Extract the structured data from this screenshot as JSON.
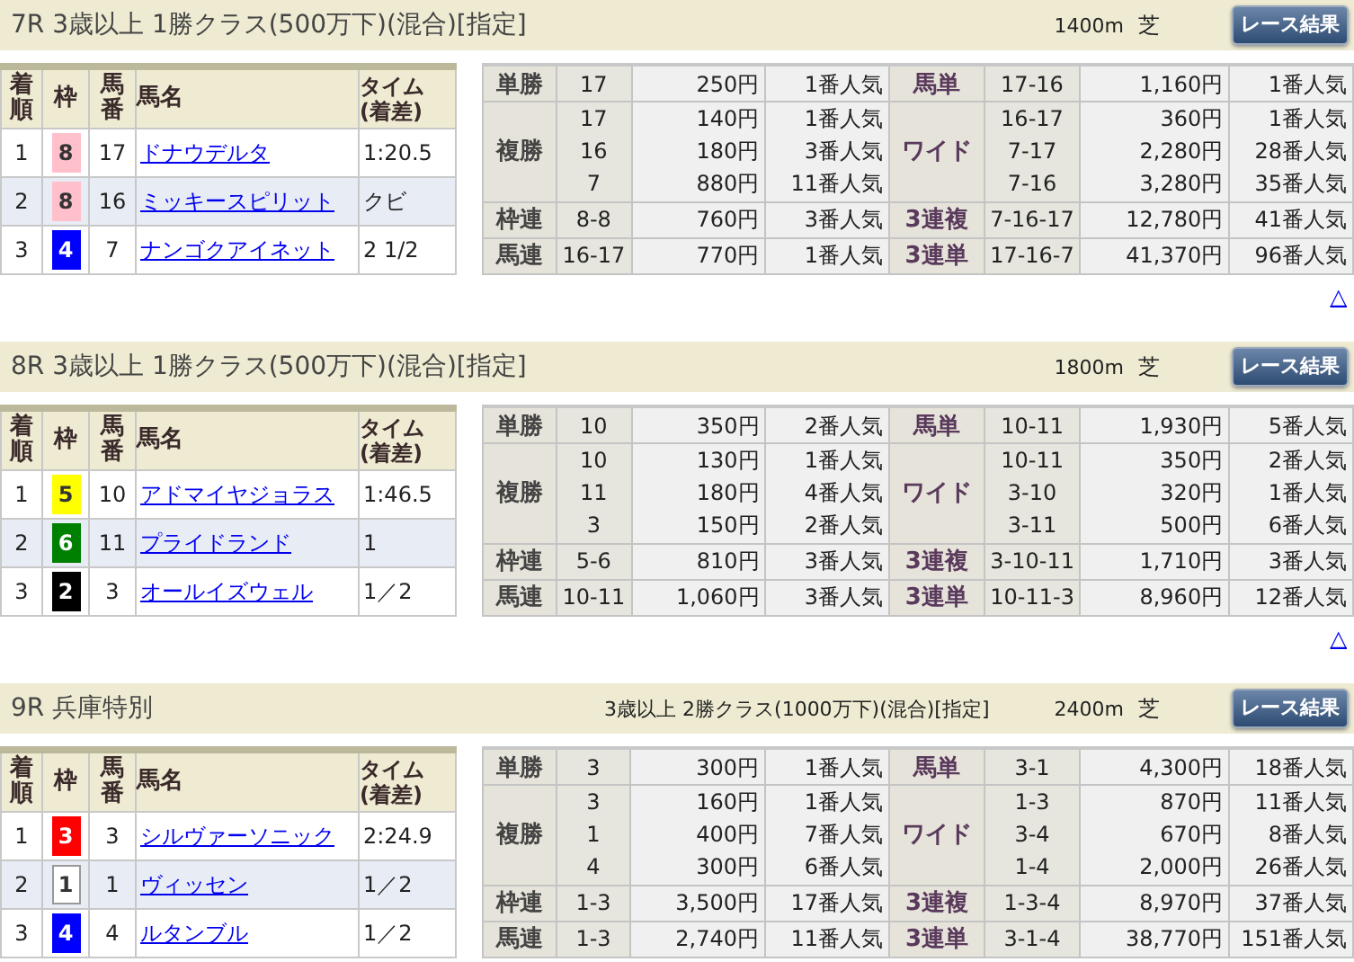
{
  "races": [
    {
      "title": "7R 3歳以上 1勝クラス(500万下)(混合)[指定]",
      "distance": "1400m",
      "surface": "芝",
      "result_button": "レース結果",
      "columns": [
        "着順",
        "枠",
        "馬番",
        "馬名",
        "タイム(着差)"
      ],
      "results": [
        {
          "rank": "1",
          "frame": "8",
          "color": "#ffc0cb",
          "horse_no": "17",
          "horse_name": "ドナウデルタ",
          "time": "1:20.5"
        },
        {
          "rank": "2",
          "frame": "8",
          "color": "#ffc0cb",
          "horse_no": "16",
          "horse_name": "ミッキースピリット",
          "time": "クビ"
        },
        {
          "rank": "3",
          "frame": "4",
          "color": "#0000ff",
          "horse_no": "7",
          "horse_name": "ナンゴクアイネット",
          "time": "2 1/2"
        }
      ],
      "payouts": [
        {
          "left": {
            "bet": "単勝",
            "entries": [
              {
                "combo": "17",
                "amount": "250円",
                "popularity": "1番人気"
              }
            ]
          },
          "right": {
            "bet": "馬単",
            "entries": [
              {
                "combo": "17-16",
                "amount": "1,160円",
                "popularity": "1番人気"
              }
            ]
          }
        },
        {
          "left": {
            "bet": "複勝",
            "entries": [
              {
                "combo": "17",
                "amount": "140円",
                "popularity": "1番人気"
              },
              {
                "combo": "16",
                "amount": "180円",
                "popularity": "3番人気"
              },
              {
                "combo": "7",
                "amount": "880円",
                "popularity": "11番人気"
              }
            ]
          },
          "right": {
            "bet": "ワイド",
            "entries": [
              {
                "combo": "16-17",
                "amount": "360円",
                "popularity": "1番人気"
              },
              {
                "combo": "7-17",
                "amount": "2,280円",
                "popularity": "28番人気"
              },
              {
                "combo": "7-16",
                "amount": "3,280円",
                "popularity": "35番人気"
              }
            ]
          }
        },
        {
          "left": {
            "bet": "枠連",
            "entries": [
              {
                "combo": "8-8",
                "amount": "760円",
                "popularity": "3番人気"
              }
            ]
          },
          "right": {
            "bet": "3連複",
            "entries": [
              {
                "combo": "7-16-17",
                "amount": "12,780円",
                "popularity": "41番人気"
              }
            ]
          }
        },
        {
          "left": {
            "bet": "馬連",
            "entries": [
              {
                "combo": "16-17",
                "amount": "770円",
                "popularity": "1番人気"
              }
            ]
          },
          "right": {
            "bet": "3連単",
            "entries": [
              {
                "combo": "17-16-7",
                "amount": "41,370円",
                "popularity": "96番人気"
              }
            ]
          }
        }
      ],
      "back_to_top": "△"
    },
    {
      "title": "8R 3歳以上 1勝クラス(500万下)(混合)[指定]",
      "distance": "1800m",
      "surface": "芝",
      "result_button": "レース結果",
      "columns": [
        "着順",
        "枠",
        "馬番",
        "馬名",
        "タイム(着差)"
      ],
      "results": [
        {
          "rank": "1",
          "frame": "5",
          "color": "#ffff00",
          "horse_no": "10",
          "horse_name": "アドマイヤジョラス",
          "time": "1:46.5"
        },
        {
          "rank": "2",
          "frame": "6",
          "color": "#008000",
          "horse_no": "11",
          "horse_name": "プライドランド",
          "time": "1"
        },
        {
          "rank": "3",
          "frame": "2",
          "color": "#000000",
          "horse_no": "3",
          "horse_name": "オールイズウェル",
          "time": "1／2"
        }
      ],
      "payouts": [
        {
          "left": {
            "bet": "単勝",
            "entries": [
              {
                "combo": "10",
                "amount": "350円",
                "popularity": "2番人気"
              }
            ]
          },
          "right": {
            "bet": "馬単",
            "entries": [
              {
                "combo": "10-11",
                "amount": "1,930円",
                "popularity": "5番人気"
              }
            ]
          }
        },
        {
          "left": {
            "bet": "複勝",
            "entries": [
              {
                "combo": "10",
                "amount": "130円",
                "popularity": "1番人気"
              },
              {
                "combo": "11",
                "amount": "180円",
                "popularity": "4番人気"
              },
              {
                "combo": "3",
                "amount": "150円",
                "popularity": "2番人気"
              }
            ]
          },
          "right": {
            "bet": "ワイド",
            "entries": [
              {
                "combo": "10-11",
                "amount": "350円",
                "popularity": "2番人気"
              },
              {
                "combo": "3-10",
                "amount": "320円",
                "popularity": "1番人気"
              },
              {
                "combo": "3-11",
                "amount": "500円",
                "popularity": "6番人気"
              }
            ]
          }
        },
        {
          "left": {
            "bet": "枠連",
            "entries": [
              {
                "combo": "5-6",
                "amount": "810円",
                "popularity": "3番人気"
              }
            ]
          },
          "right": {
            "bet": "3連複",
            "entries": [
              {
                "combo": "3-10-11",
                "amount": "1,710円",
                "popularity": "3番人気"
              }
            ]
          }
        },
        {
          "left": {
            "bet": "馬連",
            "entries": [
              {
                "combo": "10-11",
                "amount": "1,060円",
                "popularity": "3番人気"
              }
            ]
          },
          "right": {
            "bet": "3連単",
            "entries": [
              {
                "combo": "10-11-3",
                "amount": "8,960円",
                "popularity": "12番人気"
              }
            ]
          }
        }
      ],
      "back_to_top": "△"
    },
    {
      "title": "9R 兵庫特別",
      "conditions": "3歳以上 2勝クラス(1000万下)(混合)[指定]",
      "distance": "2400m",
      "surface": "芝",
      "result_button": "レース結果",
      "columns": [
        "着順",
        "枠",
        "馬番",
        "馬名",
        "タイム(着差)"
      ],
      "results": [
        {
          "rank": "1",
          "frame": "3",
          "color": "#ff0000",
          "horse_no": "3",
          "horse_name": "シルヴァーソニック",
          "time": "2:24.9"
        },
        {
          "rank": "2",
          "frame": "1",
          "color": "#ffffff",
          "horse_no": "1",
          "horse_name": "ヴィッセン",
          "time": "1／2"
        },
        {
          "rank": "3",
          "frame": "4",
          "color": "#0000ff",
          "horse_no": "4",
          "horse_name": "ルタンブル",
          "time": "1／2"
        }
      ],
      "payouts": [
        {
          "left": {
            "bet": "単勝",
            "entries": [
              {
                "combo": "3",
                "amount": "300円",
                "popularity": "1番人気"
              }
            ]
          },
          "right": {
            "bet": "馬単",
            "entries": [
              {
                "combo": "3-1",
                "amount": "4,300円",
                "popularity": "18番人気"
              }
            ]
          }
        },
        {
          "left": {
            "bet": "複勝",
            "entries": [
              {
                "combo": "3",
                "amount": "160円",
                "popularity": "1番人気"
              },
              {
                "combo": "1",
                "amount": "400円",
                "popularity": "7番人気"
              },
              {
                "combo": "4",
                "amount": "300円",
                "popularity": "6番人気"
              }
            ]
          },
          "right": {
            "bet": "ワイド",
            "entries": [
              {
                "combo": "1-3",
                "amount": "870円",
                "popularity": "11番人気"
              },
              {
                "combo": "3-4",
                "amount": "670円",
                "popularity": "8番人気"
              },
              {
                "combo": "1-4",
                "amount": "2,000円",
                "popularity": "26番人気"
              }
            ]
          }
        },
        {
          "left": {
            "bet": "枠連",
            "entries": [
              {
                "combo": "1-3",
                "amount": "3,500円",
                "popularity": "17番人気"
              }
            ]
          },
          "right": {
            "bet": "3連複",
            "entries": [
              {
                "combo": "1-3-4",
                "amount": "8,970円",
                "popularity": "37番人気"
              }
            ]
          }
        },
        {
          "left": {
            "bet": "馬連",
            "entries": [
              {
                "combo": "1-3",
                "amount": "2,740円",
                "popularity": "11番人気"
              }
            ]
          },
          "right": {
            "bet": "3連単",
            "entries": [
              {
                "combo": "3-1-4",
                "amount": "38,770円",
                "popularity": "151番人気"
              }
            ]
          }
        }
      ]
    }
  ]
}
